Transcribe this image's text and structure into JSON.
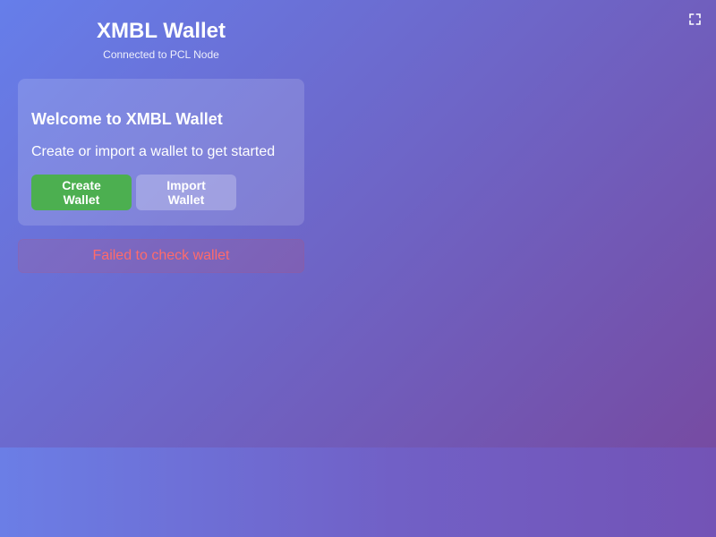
{
  "header": {
    "title": "XMBL Wallet",
    "status": "Connected to PCL Node"
  },
  "welcome": {
    "title": "Welcome to XMBL Wallet",
    "text": "Create or import a wallet to get started",
    "create_label": "Create Wallet",
    "import_label": "Import Wallet"
  },
  "error": {
    "message": "Failed to check wallet"
  },
  "toolbar": {
    "expand_icon": "fullscreen-icon"
  },
  "colors": {
    "gradient_start": "#667eea",
    "gradient_end": "#764ba2",
    "create_button": "#4caf50",
    "error_text": "#ff6b6b"
  }
}
